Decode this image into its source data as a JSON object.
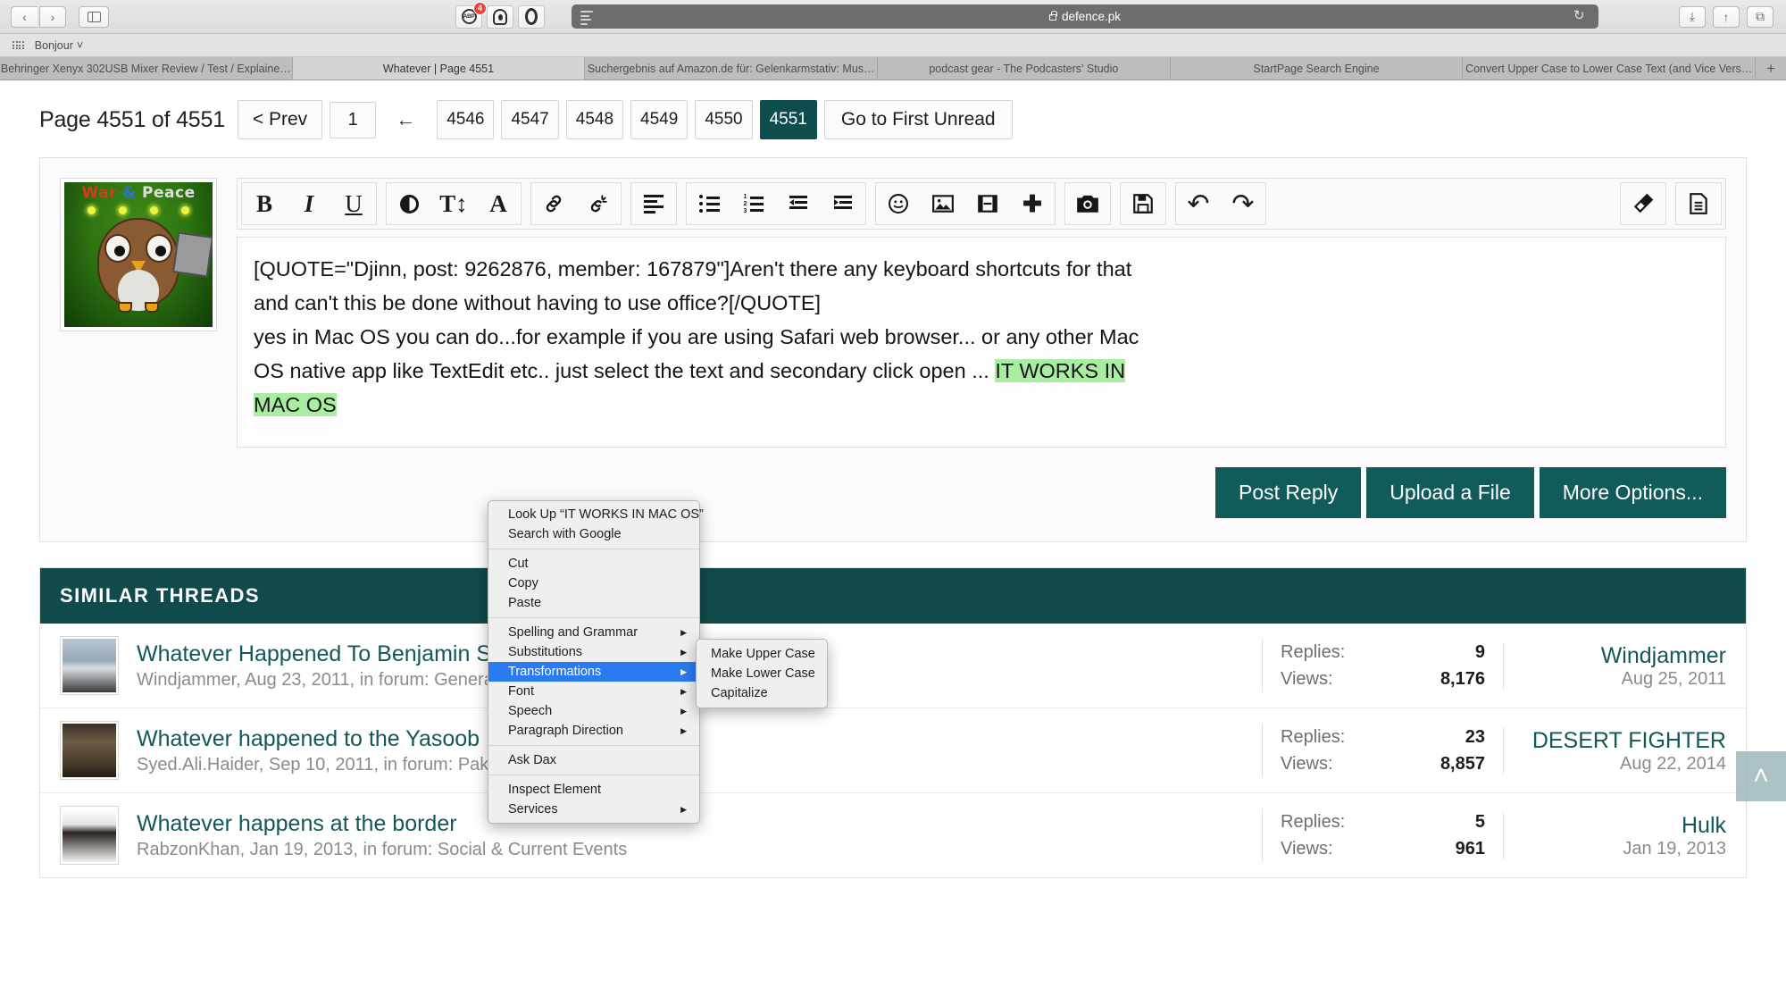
{
  "browser": {
    "url": "defence.pk",
    "lock_icon": "lock-icon",
    "back_icon": "‹",
    "forward_icon": "›",
    "reload_icon": "↻",
    "download_icon": "⤓",
    "share_icon": "↑",
    "tabs_overview_icon": "⧉",
    "extensions": [
      {
        "name": "adblock-plus",
        "glyph": "ABP",
        "badge": "4"
      },
      {
        "name": "ghostery",
        "glyph": "",
        "badge": ""
      },
      {
        "name": "privacy-badger",
        "glyph": "",
        "badge": ""
      }
    ],
    "bookmark_bar": {
      "apps_icon": "apps-grid-icon",
      "items": [
        {
          "label": "Bonjour",
          "caret": "˅"
        }
      ]
    },
    "tabs": [
      {
        "label": "Behringer Xenyx 302USB Mixer Review / Test / Explaine…",
        "active": false
      },
      {
        "label": "Whatever | Page 4551",
        "active": true
      },
      {
        "label": "Suchergebnis auf Amazon.de für: Gelenkarmstativ: Mus…",
        "active": false
      },
      {
        "label": "podcast gear - The Podcasters' Studio",
        "active": false
      },
      {
        "label": "StartPage Search Engine",
        "active": false
      },
      {
        "label": "Convert Upper Case to Lower Case Text (and Vice Vers…",
        "active": false
      }
    ],
    "new_tab_icon": "+"
  },
  "pager": {
    "label": "Page 4551 of 4551",
    "prev": "< Prev",
    "first": "1",
    "arrow": "←",
    "pages": [
      {
        "num": "4546",
        "active": false
      },
      {
        "num": "4547",
        "active": false
      },
      {
        "num": "4548",
        "active": false
      },
      {
        "num": "4549",
        "active": false
      },
      {
        "num": "4550",
        "active": false
      },
      {
        "num": "4551",
        "active": true
      }
    ],
    "goto_first_unread": "Go to First Unread"
  },
  "avatar": {
    "title_war": "War",
    "title_amp": "&",
    "title_peace": "Peace",
    "alt": "war-and-peace-owl-avatar"
  },
  "toolbar": {
    "groups": [
      {
        "name": "format-basic",
        "boxed": true,
        "buttons": [
          {
            "name": "bold-icon",
            "glyph": "B",
            "style": "serif-b"
          },
          {
            "name": "italic-icon",
            "glyph": "I",
            "style": "serif-i"
          },
          {
            "name": "underline-icon",
            "glyph": "U",
            "style": "serif-u"
          }
        ]
      },
      {
        "name": "format-color",
        "boxed": true,
        "buttons": [
          {
            "name": "text-color-icon",
            "glyph": "",
            "style": "halfcircle"
          },
          {
            "name": "font-size-icon",
            "glyph": "T↕",
            "style": "serif-a"
          },
          {
            "name": "font-family-icon",
            "glyph": "A",
            "style": "serif-a"
          }
        ]
      },
      {
        "name": "link-group",
        "boxed": true,
        "buttons": [
          {
            "name": "insert-link-icon",
            "glyph": "🔗",
            "style": "plain"
          },
          {
            "name": "unlink-icon",
            "glyph": "🔗",
            "style": "plain"
          }
        ]
      },
      {
        "name": "align-group",
        "boxed": true,
        "buttons": [
          {
            "name": "align-left-icon",
            "glyph": "",
            "style": "lines"
          }
        ]
      },
      {
        "name": "list-group",
        "boxed": true,
        "buttons": [
          {
            "name": "bullet-list-icon",
            "glyph": "",
            "style": "bullets"
          },
          {
            "name": "numbered-list-icon",
            "glyph": "",
            "style": "numlist"
          },
          {
            "name": "outdent-icon",
            "glyph": "⬅",
            "style": "indent"
          },
          {
            "name": "indent-icon",
            "glyph": "➡",
            "style": "indent"
          }
        ]
      },
      {
        "name": "insert-group",
        "boxed": true,
        "buttons": [
          {
            "name": "emoji-icon",
            "glyph": "☺",
            "style": "plain"
          },
          {
            "name": "insert-image-icon",
            "glyph": "🏞",
            "style": "plain"
          },
          {
            "name": "insert-video-icon",
            "glyph": "🎞",
            "style": "plain"
          },
          {
            "name": "insert-more-icon",
            "glyph": "✚",
            "style": "plain"
          }
        ]
      },
      {
        "name": "camera-group",
        "boxed": true,
        "buttons": [
          {
            "name": "camera-icon",
            "glyph": "📷",
            "style": "plain"
          }
        ]
      },
      {
        "name": "save-group",
        "boxed": true,
        "buttons": [
          {
            "name": "save-draft-icon",
            "glyph": "💾",
            "style": "plain"
          }
        ]
      },
      {
        "name": "history-group",
        "boxed": true,
        "buttons": [
          {
            "name": "undo-icon",
            "glyph": "↶",
            "style": "plain"
          },
          {
            "name": "redo-icon",
            "glyph": "↷",
            "style": "plain"
          }
        ]
      }
    ],
    "right_groups": [
      {
        "name": "eraser-group",
        "boxed": true,
        "buttons": [
          {
            "name": "remove-formatting-eraser-icon",
            "glyph": "◥",
            "style": "plain"
          }
        ]
      },
      {
        "name": "source-group",
        "boxed": true,
        "buttons": [
          {
            "name": "toggle-bb-code-icon",
            "glyph": "🗎",
            "style": "plain"
          }
        ]
      }
    ]
  },
  "editor": {
    "line1": "[QUOTE=\"Djinn, post: 9262876, member: 167879\"]Aren't there any keyboard shortcuts for that",
    "line2": "and can't this be done without having to use office?[/QUOTE]",
    "line3_plain": "yes in Mac OS you can do...for example if you are using Safari web browser... or any other Mac",
    "line4_plain": "OS native app like TextEdit etc.. just select the text and secondary click open ... ",
    "line4_highlight": "IT WORKS IN",
    "line5_highlight": "MAC OS"
  },
  "actions": {
    "post_reply": "Post Reply",
    "upload_file": "Upload a File",
    "more_options": "More Options..."
  },
  "context_menu": {
    "items": [
      {
        "label": "Look Up “IT WORKS IN MAC OS”",
        "submenu": false,
        "selected": false
      },
      {
        "label": "Search with Google",
        "submenu": false,
        "selected": false
      },
      {
        "sep": true
      },
      {
        "label": "Cut",
        "submenu": false,
        "selected": false
      },
      {
        "label": "Copy",
        "submenu": false,
        "selected": false
      },
      {
        "label": "Paste",
        "submenu": false,
        "selected": false
      },
      {
        "sep": true
      },
      {
        "label": "Spelling and Grammar",
        "submenu": true,
        "selected": false
      },
      {
        "label": "Substitutions",
        "submenu": true,
        "selected": false
      },
      {
        "label": "Transformations",
        "submenu": true,
        "selected": true
      },
      {
        "label": "Font",
        "submenu": true,
        "selected": false
      },
      {
        "label": "Speech",
        "submenu": true,
        "selected": false
      },
      {
        "label": "Paragraph Direction",
        "submenu": true,
        "selected": false
      },
      {
        "sep": true
      },
      {
        "label": "Ask Dax",
        "submenu": false,
        "selected": false
      },
      {
        "sep": true
      },
      {
        "label": "Inspect Element",
        "submenu": false,
        "selected": false
      },
      {
        "label": "Services",
        "submenu": true,
        "selected": false
      }
    ],
    "submenu_arrow": "▶",
    "submenu": {
      "items": [
        {
          "label": "Make Upper Case"
        },
        {
          "label": "Make Lower Case"
        },
        {
          "label": "Capitalize"
        }
      ]
    }
  },
  "similar_threads": {
    "heading": "SIMILAR THREADS",
    "labels": {
      "replies": "Replies:",
      "views": "Views:"
    },
    "rows": [
      {
        "title": "Whatever Happened To Benjamin Sisters",
        "meta": "Windjammer, Aug 23, 2011, in forum: General Photos & Multimedia",
        "replies": "9",
        "views": "8,176",
        "last_user": "Windjammer",
        "last_date": "Aug 25, 2011",
        "thumb": "thumb-1"
      },
      {
        "title": "Whatever happened to the Yasoob Project?",
        "meta": "Syed.Ali.Haider, Sep 10, 2011, in forum: Pakistan Army",
        "replies": "23",
        "views": "8,857",
        "last_user": "DESERT FIGHTER",
        "last_date": "Aug 22, 2014",
        "thumb": "thumb-2"
      },
      {
        "title": "Whatever happens at the border",
        "meta": "RabzonKhan, Jan 19, 2013, in forum: Social & Current Events",
        "replies": "5",
        "views": "961",
        "last_user": "Hulk",
        "last_date": "Jan 19, 2013",
        "thumb": "thumb-3"
      }
    ]
  },
  "scroll_top": {
    "icon": "˄"
  },
  "colors": {
    "accent_dark": "#114a4a",
    "accent_button": "#125b5b",
    "link": "#13575a",
    "highlight": "#a8eda1",
    "menu_selected": "#2a7bf0"
  }
}
